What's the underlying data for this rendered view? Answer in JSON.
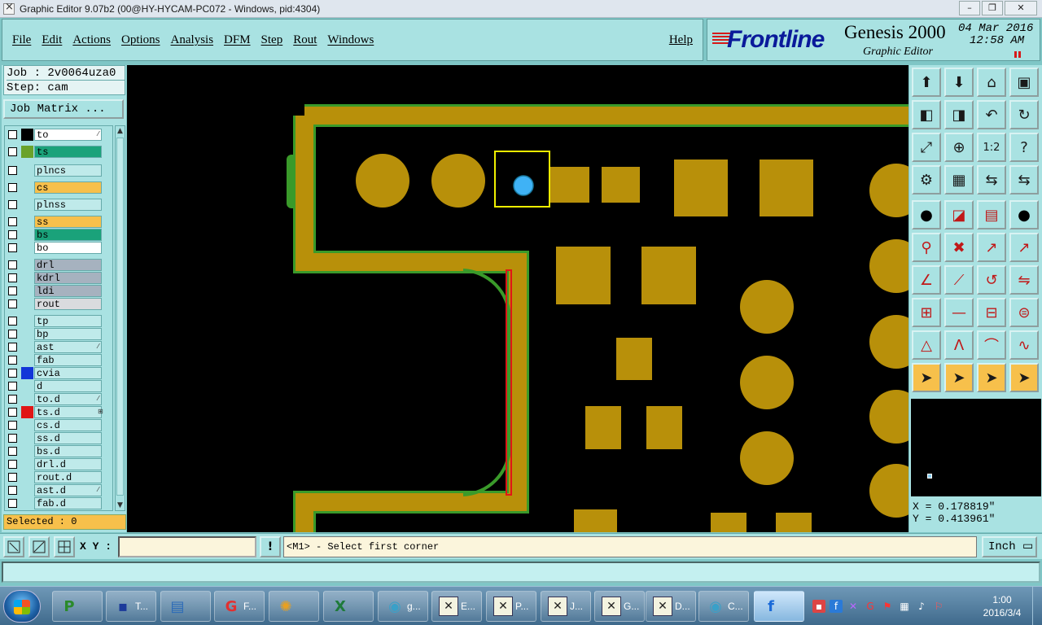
{
  "window": {
    "title": "Graphic Editor 9.07b2 (00@HY-HYCAM-PC072 - Windows, pid:4304)",
    "min": "–",
    "max": "❐",
    "close": "✕"
  },
  "menu": {
    "items": [
      "File",
      "Edit",
      "Actions",
      "Options",
      "Analysis",
      "DFM",
      "Step",
      "Rout",
      "Windows"
    ],
    "help": "Help"
  },
  "brand": {
    "logo": "Frontline",
    "product": "Genesis 2000",
    "subtitle": "Graphic Editor",
    "date": "04 Mar 2016",
    "time": "12:58  AM"
  },
  "job": {
    "job_line": "Job : 2v0064uza0",
    "step_line": "Step: cam",
    "matrix_button": "Job Matrix ..."
  },
  "layers": [
    {
      "name": "to",
      "color": "#ffffff",
      "swatch": "#000000",
      "mark": "⁄"
    },
    {
      "name": "ts",
      "color": "#1aa27a",
      "swatch": "#6aa22a",
      "mark": ""
    },
    {
      "name": "plncs",
      "color": "#bfeaea",
      "swatch": "#a9e2e2",
      "mark": ""
    },
    {
      "name": "cs",
      "color": "#f7c04b",
      "swatch": "#a9e2e2",
      "mark": ""
    },
    {
      "name": "plnss",
      "color": "#bfeaea",
      "swatch": "#a9e2e2",
      "mark": ""
    },
    {
      "name": "ss",
      "color": "#f7c04b",
      "swatch": "#a9e2e2",
      "mark": ""
    },
    {
      "name": "bs",
      "color": "#1aa27a",
      "swatch": "#a9e2e2",
      "mark": ""
    },
    {
      "name": "bo",
      "color": "#ffffff",
      "swatch": "#a9e2e2",
      "mark": ""
    },
    {
      "name": "drl",
      "color": "#a6b2bf",
      "swatch": "#a9e2e2",
      "mark": ""
    },
    {
      "name": "kdrl",
      "color": "#a6b2bf",
      "swatch": "#a9e2e2",
      "mark": ""
    },
    {
      "name": "ldi",
      "color": "#a6b2bf",
      "swatch": "#a9e2e2",
      "mark": ""
    },
    {
      "name": "rout",
      "color": "#d9dbde",
      "swatch": "#a9e2e2",
      "mark": ""
    },
    {
      "name": "tp",
      "color": "#bfeaea",
      "swatch": "#a9e2e2",
      "mark": ""
    },
    {
      "name": "bp",
      "color": "#bfeaea",
      "swatch": "#a9e2e2",
      "mark": ""
    },
    {
      "name": "ast",
      "color": "#bfeaea",
      "swatch": "#a9e2e2",
      "mark": "⁄"
    },
    {
      "name": "fab",
      "color": "#bfeaea",
      "swatch": "#a9e2e2",
      "mark": ""
    },
    {
      "name": "cvia",
      "color": "#bfeaea",
      "swatch": "#1336d8",
      "mark": ""
    },
    {
      "name": "d",
      "color": "#bfeaea",
      "swatch": "#a9e2e2",
      "mark": ""
    },
    {
      "name": "to.d",
      "color": "#bfeaea",
      "swatch": "#a9e2e2",
      "mark": "⁄"
    },
    {
      "name": "ts.d",
      "color": "#bfeaea",
      "swatch": "#e01616",
      "mark": "⊞"
    },
    {
      "name": "cs.d",
      "color": "#bfeaea",
      "swatch": "#a9e2e2",
      "mark": ""
    },
    {
      "name": "ss.d",
      "color": "#bfeaea",
      "swatch": "#a9e2e2",
      "mark": ""
    },
    {
      "name": "bs.d",
      "color": "#bfeaea",
      "swatch": "#a9e2e2",
      "mark": ""
    },
    {
      "name": "drl.d",
      "color": "#bfeaea",
      "swatch": "#a9e2e2",
      "mark": ""
    },
    {
      "name": "rout.d",
      "color": "#bfeaea",
      "swatch": "#a9e2e2",
      "mark": ""
    },
    {
      "name": "ast.d",
      "color": "#bfeaea",
      "swatch": "#a9e2e2",
      "mark": "⁄"
    },
    {
      "name": "fab.d",
      "color": "#bfeaea",
      "swatch": "#a9e2e2",
      "mark": ""
    }
  ],
  "selected": "Selected : 0",
  "coords": {
    "x": "X = 0.178819\"",
    "y": "Y = 0.413961\""
  },
  "status": {
    "xy_label": "X Y :",
    "xy_value": "",
    "prompt": "<M1> - Select first corner",
    "unit": "Inch ▭"
  },
  "taskbar": {
    "items": [
      {
        "label": "",
        "icon": "frontline-p-icon"
      },
      {
        "label": "T...",
        "icon": "save-disk-icon"
      },
      {
        "label": "",
        "icon": "document-icon"
      },
      {
        "label": "F...",
        "icon": "red-app-icon"
      },
      {
        "label": "",
        "icon": "shell-icon"
      },
      {
        "label": "",
        "icon": "excel-icon"
      },
      {
        "label": "g...",
        "icon": "eye-icon"
      },
      {
        "label": "E...",
        "icon": "xwindow-icon"
      },
      {
        "label": "P...",
        "icon": "xwindow-icon"
      },
      {
        "label": "J...",
        "icon": "xwindow-icon"
      },
      {
        "label": "G...",
        "icon": "xwindow-icon"
      },
      {
        "label": "D...",
        "icon": "xwindow-icon"
      },
      {
        "label": "C...",
        "icon": "eye-icon"
      },
      {
        "label": "",
        "icon": "frontline-f-icon"
      }
    ],
    "clock_time": "1:00",
    "clock_date": "2016/3/4"
  },
  "colors": {
    "pad": "#b8900a",
    "board_edge": "#3a9a2a",
    "selection_box": "#f0f000",
    "via": "#3fb2f5",
    "panel": "#a9e2e2"
  }
}
